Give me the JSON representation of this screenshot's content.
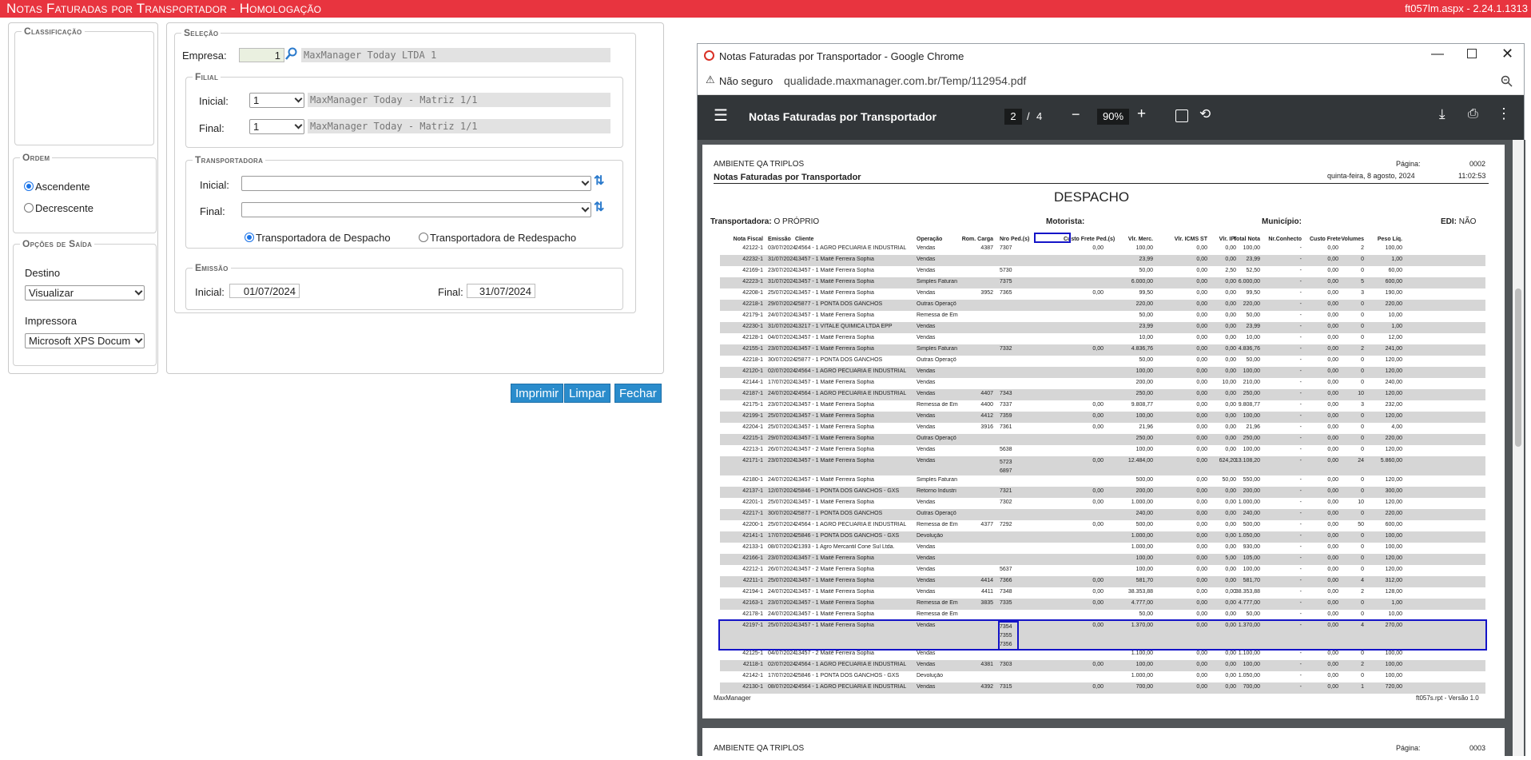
{
  "app": {
    "title": "Notas Faturadas por Transportador  - Homologação",
    "version": "ft057lm.aspx - 2.24.1.1313"
  },
  "classificacao": {
    "legend": "Classificação"
  },
  "ordem": {
    "legend": "Ordem",
    "asc": "Ascendente",
    "desc": "Decrescente"
  },
  "saida": {
    "legend": "Opções de Saída",
    "destino_label": "Destino",
    "destino_value": "Visualizar",
    "impressora_label": "Impressora",
    "impressora_value": "Microsoft XPS Docum"
  },
  "selecao": {
    "legend": "Seleção",
    "empresa_label": "Empresa:",
    "empresa_value": "1",
    "empresa_name": "MaxManager Today LTDA 1"
  },
  "filial": {
    "legend": "Filial",
    "inicial_label": "Inicial:",
    "inicial_value": "1",
    "inicial_name": "MaxManager Today - Matriz 1/1",
    "final_label": "Final:",
    "final_value": "1",
    "final_name": "MaxManager Today - Matriz 1/1"
  },
  "transportadora": {
    "legend": "Transportadora",
    "inicial_label": "Inicial:",
    "final_label": "Final:",
    "despacho": "Transportadora de Despacho",
    "redespacho": "Transportadora de Redespacho"
  },
  "emissao": {
    "legend": "Emissão",
    "inicial_label": "Inicial:",
    "inicial_value": "01/07/2024",
    "final_label": "Final:",
    "final_value": "31/07/2024"
  },
  "buttons": {
    "imprimir": "Imprimir",
    "limpar": "Limpar",
    "fechar": "Fechar"
  },
  "browser": {
    "title": "Notas Faturadas por Transportador - Google Chrome",
    "security": "Não seguro",
    "url": "qualidade.maxmanager.com.br/Temp/112954.pdf"
  },
  "pdf": {
    "doc_title": "Notas Faturadas por Transportador",
    "page": "2",
    "pages": "4",
    "zoom": "90%"
  },
  "report": {
    "ambiente": "AMBIENTE QA TRIPLOS",
    "pagina_label": "Página:",
    "pagina": "0002",
    "title": "Notas Faturadas por Transportador",
    "date": "quinta-feira, 8 agosto, 2024",
    "time": "11:02:53",
    "section": "DESPACHO",
    "transp_label": "Transportadora:",
    "transp_value": "O PRÓPRIO",
    "motorista": "Motorista:",
    "municipio": "Município:",
    "edi_label": "EDI:",
    "edi_value": "NÃO",
    "footer_left": "MaxManager",
    "footer_right": "ft057s.rpt  -  Versão 1.0",
    "next_ambiente": "AMBIENTE QA TRIPLOS",
    "next_pagina_label": "Página:",
    "next_pagina": "0003",
    "columns": [
      "Nota Fiscal",
      "Emissão",
      "Cliente",
      "Operação",
      "Rom. Carga",
      "Nro Ped.(s)",
      "Custo Frete Ped.(s)",
      "Vlr. Merc.",
      "Vlr. ICMS ST",
      "Vlr. IPI",
      "Total Nota",
      "Nr.Conhecto",
      "Custo Frete",
      "Volumes",
      "Peso Líq."
    ],
    "rows": [
      [
        "42122-1",
        "03/07/2024",
        "24564 - 1 AGRO PECUARIA E INDUSTRIAL",
        "Vendas",
        "4387",
        "7307",
        "0,00",
        "100,00",
        "0,00",
        "0,00",
        "100,00",
        "-",
        "0,00",
        "2",
        "100,00"
      ],
      [
        "42232-1",
        "31/07/2024",
        "13457 - 1 Maitê Ferreira Sophia",
        "Vendas",
        "",
        "",
        "",
        "23,99",
        "0,00",
        "0,00",
        "23,99",
        "-",
        "0,00",
        "0",
        "1,00"
      ],
      [
        "42169-1",
        "23/07/2024",
        "13457 - 1 Maitê Ferreira Sophia",
        "Vendas",
        "",
        "5730",
        "",
        "50,00",
        "0,00",
        "2,50",
        "52,50",
        "-",
        "0,00",
        "0",
        "60,00"
      ],
      [
        "42223-1",
        "31/07/2024",
        "13457 - 1 Maitê Ferreira Sophia",
        "Simples Faturan",
        "",
        "7375",
        "",
        "6.000,00",
        "0,00",
        "0,00",
        "6.000,00",
        "-",
        "0,00",
        "5",
        "600,00"
      ],
      [
        "42208-1",
        "25/07/2024",
        "13457 - 1 Maitê Ferreira Sophia",
        "Vendas",
        "3952",
        "7365",
        "0,00",
        "99,50",
        "0,00",
        "0,00",
        "99,50",
        "-",
        "0,00",
        "3",
        "190,00"
      ],
      [
        "42218-1",
        "29/07/2024",
        "25877 - 1 PONTA DOS GANCHOS",
        "Outras Operaçõ",
        "",
        "",
        "",
        "220,00",
        "0,00",
        "0,00",
        "220,00",
        "-",
        "0,00",
        "0",
        "220,00"
      ],
      [
        "42179-1",
        "24/07/2024",
        "13457 - 1 Maitê Ferreira Sophia",
        "Remessa de Em",
        "",
        "",
        "",
        "50,00",
        "0,00",
        "0,00",
        "50,00",
        "-",
        "0,00",
        "0",
        "10,00"
      ],
      [
        "42230-1",
        "31/07/2024",
        "13217 - 1  VITALE QUIMICA LTDA EPP",
        "Vendas",
        "",
        "",
        "",
        "23,99",
        "0,00",
        "0,00",
        "23,99",
        "-",
        "0,00",
        "0",
        "1,00"
      ],
      [
        "42128-1",
        "04/07/2024",
        "13457 - 1 Maitê Ferreira Sophia",
        "Vendas",
        "",
        "",
        "",
        "10,00",
        "0,00",
        "0,00",
        "10,00",
        "-",
        "0,00",
        "0",
        "12,00"
      ],
      [
        "42155-1",
        "23/07/2024",
        "13457 - 1 Maitê Ferreira Sophia",
        "Simples Faturan",
        "",
        "7332",
        "0,00",
        "4.836,76",
        "0,00",
        "0,00",
        "4.836,76",
        "-",
        "0,00",
        "2",
        "241,00"
      ],
      [
        "42218-1",
        "30/07/2024",
        "25877 - 1 PONTA DOS GANCHOS",
        "Outras Operaçõ",
        "",
        "",
        "",
        "50,00",
        "0,00",
        "0,00",
        "50,00",
        "-",
        "0,00",
        "0",
        "120,00"
      ],
      [
        "42120-1",
        "02/07/2024",
        "24564 - 1 AGRO PECUARIA E INDUSTRIAL",
        "Vendas",
        "",
        "",
        "",
        "100,00",
        "0,00",
        "0,00",
        "100,00",
        "-",
        "0,00",
        "0",
        "120,00"
      ],
      [
        "42144-1",
        "17/07/2024",
        "13457 - 1 Maitê Ferreira Sophia",
        "Vendas",
        "",
        "",
        "",
        "200,00",
        "0,00",
        "10,00",
        "210,00",
        "-",
        "0,00",
        "0",
        "240,00"
      ],
      [
        "42187-1",
        "24/07/2024",
        "24564 - 1 AGRO PECUARIA E INDUSTRIAL",
        "Vendas",
        "4407",
        "7343",
        "",
        "250,00",
        "0,00",
        "0,00",
        "250,00",
        "-",
        "0,00",
        "10",
        "120,00"
      ],
      [
        "42175-1",
        "23/07/2024",
        "13457 - 1 Maitê Ferreira Sophia",
        "Remessa de Em",
        "4400",
        "7337",
        "0,00",
        "9.808,77",
        "0,00",
        "0,00",
        "9.808,77",
        "-",
        "0,00",
        "3",
        "232,00"
      ],
      [
        "42199-1",
        "25/07/2024",
        "13457 - 1 Maitê Ferreira Sophia",
        "Vendas",
        "4412",
        "7359",
        "0,00",
        "100,00",
        "0,00",
        "0,00",
        "100,00",
        "-",
        "0,00",
        "0",
        "120,00"
      ],
      [
        "42204-1",
        "25/07/2024",
        "13457 - 1 Maitê Ferreira Sophia",
        "Vendas",
        "3916",
        "7361",
        "0,00",
        "21,96",
        "0,00",
        "0,00",
        "21,96",
        "-",
        "0,00",
        "0",
        "4,00"
      ],
      [
        "42215-1",
        "29/07/2024",
        "13457 - 1 Maitê Ferreira Sophia",
        "Outras Operaçõ",
        "",
        "",
        "",
        "250,00",
        "0,00",
        "0,00",
        "250,00",
        "-",
        "0,00",
        "0",
        "220,00"
      ],
      [
        "42213-1",
        "26/07/2024",
        "13457 - 2 Maitê Ferreira Sophia",
        "Vendas",
        "",
        "5638",
        "",
        "100,00",
        "0,00",
        "0,00",
        "100,00",
        "-",
        "0,00",
        "0",
        "120,00"
      ],
      [
        "42171-1",
        "23/07/2024",
        "13457 - 1 Maitê Ferreira Sophia",
        "Vendas",
        "",
        "5723 6897",
        "0,00",
        "12.484,00",
        "0,00",
        "624,20",
        "13.108,20",
        "-",
        "0,00",
        "24",
        "5.860,00"
      ],
      [
        "42180-1",
        "24/07/2024",
        "13457 - 1 Maitê Ferreira Sophia",
        "Simples Faturan",
        "",
        "",
        "",
        "500,00",
        "0,00",
        "50,00",
        "550,00",
        "-",
        "0,00",
        "0",
        "120,00"
      ],
      [
        "42137-1",
        "12/07/2024",
        "25846 - 1 PONTA DOS GANCHOS - GXS",
        "Retorno Industri",
        "",
        "7321",
        "0,00",
        "200,00",
        "0,00",
        "0,00",
        "200,00",
        "-",
        "0,00",
        "0",
        "300,00"
      ],
      [
        "42201-1",
        "25/07/2024",
        "13457 - 1 Maitê Ferreira Sophia",
        "Vendas",
        "",
        "7302",
        "0,00",
        "1.000,00",
        "0,00",
        "0,00",
        "1.000,00",
        "-",
        "0,00",
        "10",
        "120,00"
      ],
      [
        "42217-1",
        "30/07/2024",
        "25877 - 1 PONTA DOS GANCHOS",
        "Outras Operaçõ",
        "",
        "",
        "",
        "240,00",
        "0,00",
        "0,00",
        "240,00",
        "-",
        "0,00",
        "0",
        "220,00"
      ],
      [
        "42200-1",
        "25/07/2024",
        "24564 - 1 AGRO PECUARIA E INDUSTRIAL",
        "Remessa de Em",
        "4377",
        "7292",
        "0,00",
        "500,00",
        "0,00",
        "0,00",
        "500,00",
        "-",
        "0,00",
        "50",
        "600,00"
      ],
      [
        "42141-1",
        "17/07/2024",
        "25846 - 1 PONTA DOS GANCHOS - GXS",
        "Devolução",
        "",
        "",
        "",
        "1.000,00",
        "0,00",
        "0,00",
        "1.050,00",
        "-",
        "0,00",
        "0",
        "100,00"
      ],
      [
        "42133-1",
        "08/07/2024",
        "21393 - 1 Agro Mercantil Cone Sul Ltda.",
        "Vendas",
        "",
        "",
        "",
        "1.000,00",
        "0,00",
        "0,00",
        "930,00",
        "-",
        "0,00",
        "0",
        "100,00"
      ],
      [
        "42166-1",
        "23/07/2024",
        "13457 - 1 Maitê Ferreira Sophia",
        "Vendas",
        "",
        "",
        "",
        "100,00",
        "0,00",
        "5,00",
        "105,00",
        "-",
        "0,00",
        "0",
        "120,00"
      ],
      [
        "42212-1",
        "26/07/2024",
        "13457 - 2 Maitê Ferreira Sophia",
        "Vendas",
        "",
        "5637",
        "",
        "100,00",
        "0,00",
        "0,00",
        "100,00",
        "-",
        "0,00",
        "0",
        "120,00"
      ],
      [
        "42211-1",
        "25/07/2024",
        "13457 - 1 Maitê Ferreira Sophia",
        "Vendas",
        "4414",
        "7366",
        "0,00",
        "581,70",
        "0,00",
        "0,00",
        "581,70",
        "-",
        "0,00",
        "4",
        "312,00"
      ],
      [
        "42194-1",
        "24/07/2024",
        "13457 - 1 Maitê Ferreira Sophia",
        "Vendas",
        "4411",
        "7348",
        "0,00",
        "38.353,88",
        "0,00",
        "0,00",
        "38.353,88",
        "-",
        "0,00",
        "2",
        "128,00"
      ],
      [
        "42163-1",
        "23/07/2024",
        "13457 - 1 Maitê Ferreira Sophia",
        "Remessa de Em",
        "3835",
        "7335",
        "0,00",
        "4.777,00",
        "0,00",
        "0,00",
        "4.777,00",
        "-",
        "0,00",
        "0",
        "1,00"
      ],
      [
        "42178-1",
        "24/07/2024",
        "13457 - 1 Maitê Ferreira Sophia",
        "Remessa de Em",
        "",
        "",
        "",
        "50,00",
        "0,00",
        "0,00",
        "50,00",
        "-",
        "0,00",
        "0",
        "10,00"
      ],
      [
        "42197-1",
        "25/07/2024",
        "13457 - 1 Maitê Ferreira Sophia",
        "Vendas",
        "",
        "7354 7355 7356",
        "0,00",
        "1.370,00",
        "0,00",
        "0,00",
        "1.370,00",
        "-",
        "0,00",
        "4",
        "270,00"
      ],
      [
        "42125-1",
        "04/07/2024",
        "13457 - 2 Maitê Ferreira Sophia",
        "Vendas",
        "",
        "",
        "",
        "1.100,00",
        "0,00",
        "0,00",
        "1.100,00",
        "-",
        "0,00",
        "0",
        "100,00"
      ],
      [
        "42118-1",
        "02/07/2024",
        "24564 - 1 AGRO PECUARIA E INDUSTRIAL",
        "Vendas",
        "4381",
        "7303",
        "0,00",
        "100,00",
        "0,00",
        "0,00",
        "100,00",
        "-",
        "0,00",
        "2",
        "100,00"
      ],
      [
        "42142-1",
        "17/07/2024",
        "25846 - 1 PONTA DOS GANCHOS - GXS",
        "Devolução",
        "",
        "",
        "",
        "1.000,00",
        "0,00",
        "0,00",
        "1.050,00",
        "-",
        "0,00",
        "0",
        "100,00"
      ],
      [
        "42130-1",
        "08/07/2024",
        "24564 - 1 AGRO PECUARIA E INDUSTRIAL",
        "Vendas",
        "4392",
        "7315",
        "0,00",
        "700,00",
        "0,00",
        "0,00",
        "700,00",
        "-",
        "0,00",
        "1",
        "720,00"
      ]
    ]
  }
}
